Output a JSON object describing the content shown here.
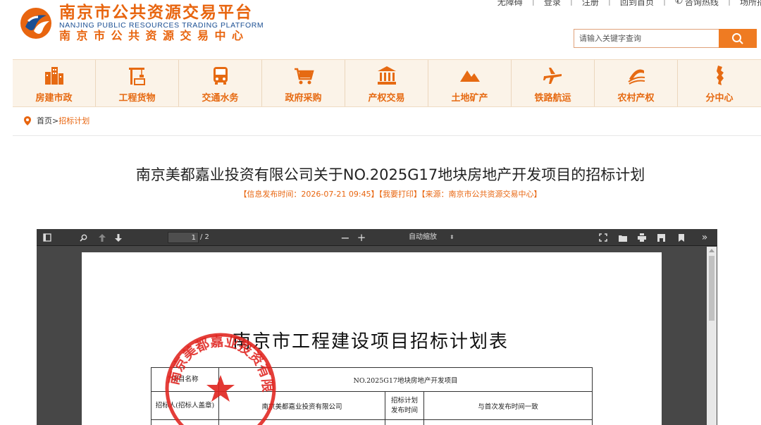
{
  "header": {
    "logo_cn": "南京市公共资源交易平台",
    "logo_en": "NANJING PUBLIC RESOURCES TRADING PLATFORM",
    "logo_cn2": "南京市公共资源交易中心",
    "top_links": [
      {
        "label": "无障碍"
      },
      {
        "label": "登录"
      },
      {
        "label": "注册"
      },
      {
        "label": "回到首页"
      },
      {
        "label": "咨询热线"
      },
      {
        "label": "场所指"
      }
    ],
    "search_placeholder": "请输入关键字查询"
  },
  "nav": {
    "items": [
      {
        "label": "房建市政",
        "icon": "buildings-icon"
      },
      {
        "label": "工程货物",
        "icon": "crane-icon"
      },
      {
        "label": "交通水务",
        "icon": "bus-icon"
      },
      {
        "label": "政府采购",
        "icon": "cart-icon"
      },
      {
        "label": "产权交易",
        "icon": "bank-icon"
      },
      {
        "label": "土地矿产",
        "icon": "mountain-icon"
      },
      {
        "label": "铁路航运",
        "icon": "airplane-icon"
      },
      {
        "label": "农村产权",
        "icon": "farmland-icon"
      },
      {
        "label": "分中心",
        "icon": "map-icon"
      }
    ]
  },
  "breadcrumb": {
    "home": "首页>",
    "current": "招标计划"
  },
  "article": {
    "title": "南京美都嘉业投资有限公司关于NO.2025G17地块房地产开发项目的招标计划",
    "meta": "【信息发布时间：2026-07-21 09:45】【我要打印】【来源：南京市公共资源交易中心】"
  },
  "pdf_viewer": {
    "page_input": "1",
    "page_count": "/ 2",
    "zoom_label": "自动缩放",
    "doc_title": "南京市工程建设项目招标计划表",
    "table": {
      "row1_label": "项目名称",
      "row1_value": "NO.2025G17地块房地产开发项目",
      "row2_label": "招标人(招标人盖章)",
      "row2_value": "南京美都嘉业投资有限公司",
      "row2_label2": "招标计划发布时间",
      "row2_value2": "与首次发布时间一致"
    },
    "stamp_text": "南京美都嘉业投资有限公司"
  },
  "colors": {
    "brand_orange": "#e8650f",
    "brand_blue": "#1b4f93",
    "nav_bg": "#fbf3e8",
    "pdf_toolbar": "#383838"
  }
}
